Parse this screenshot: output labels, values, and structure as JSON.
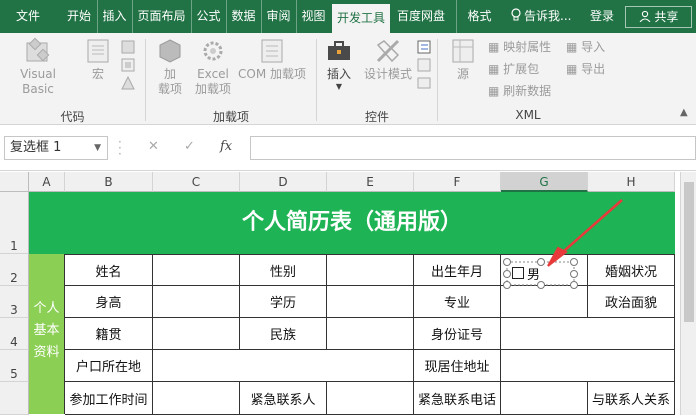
{
  "tabs": [
    {
      "label": "文件"
    },
    {
      "label": "开始"
    },
    {
      "label": "插入"
    },
    {
      "label": "页面布局"
    },
    {
      "label": "公式"
    },
    {
      "label": "数据"
    },
    {
      "label": "审阅"
    },
    {
      "label": "视图"
    },
    {
      "label": "开发工具",
      "active": true
    },
    {
      "label": "百度网盘"
    },
    {
      "label": "格式"
    }
  ],
  "tellme": "告诉我...",
  "login": "登录",
  "share": "共享",
  "ribbon": {
    "code": {
      "label": "代码",
      "visual_basic": "Visual Basic",
      "macro": "宏"
    },
    "addins": {
      "label": "加载项",
      "addin_line1": "加",
      "addin_line2": "载项",
      "excel_addin_line1": "Excel",
      "excel_addin_line2": "加载项",
      "com_addin": "COM 加载项"
    },
    "controls": {
      "label": "控件",
      "insert": "插入",
      "design_mode": "设计模式"
    },
    "xml": {
      "label": "XML",
      "source": "源",
      "map_properties": "映射属性",
      "expansion_pack": "扩展包",
      "refresh_data": "刷新数据",
      "import": "导入",
      "export": "导出"
    }
  },
  "formula_bar": {
    "name_box": "复选框 1",
    "fx": "fx",
    "content": ""
  },
  "columns": [
    "A",
    "B",
    "C",
    "D",
    "E",
    "F",
    "G",
    "H"
  ],
  "rows": [
    "1",
    "2",
    "3",
    "4",
    "5"
  ],
  "sheet": {
    "title": "个人简历表（通用版）",
    "side_label": "个人基本资料",
    "side_lines": [
      "个人",
      "基本",
      "资料"
    ],
    "r2": {
      "name": "姓名",
      "gender": "性别",
      "birth": "出生年月",
      "marital": "婚姻状况"
    },
    "r3": {
      "height": "身高",
      "education": "学历",
      "major": "专业",
      "political": "政治面貌"
    },
    "r4": {
      "native": "籍贯",
      "ethnicity": "民族",
      "id": "身份证号"
    },
    "r5": {
      "hukou": "户口所在地",
      "address": "现居住地址"
    },
    "r6": {
      "work_time": "参加工作时间",
      "emergency": "紧急联系人",
      "emergency_phone": "紧急联系电话",
      "relation": "与联系人关系"
    },
    "checkbox_label": "男"
  },
  "colors": {
    "excel_green": "#217346",
    "title_green": "#1eb354",
    "side_green": "#8ccf55",
    "arrow_red": "#e83a3a"
  }
}
